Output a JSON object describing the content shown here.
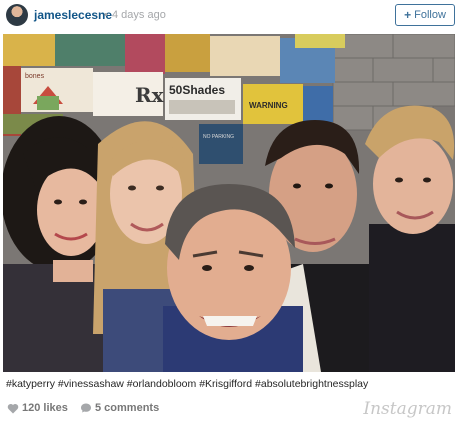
{
  "post": {
    "username": "jameslecesne",
    "separator": "•",
    "time_ago": "4 days ago",
    "follow_label": "Follow",
    "caption": "#katyperry #vinessashaw #orlandobloom #Krisgifford #absolutebrightnessplay",
    "likes": "120 likes",
    "comments": "5 comments",
    "brand": "Instagram"
  },
  "photo_signs": {
    "sign_1": "50Shades",
    "sign_2": "WARNING",
    "sign_3": "Rx",
    "sign_4": "bones",
    "sign_5": "NO PARKING"
  },
  "colors": {
    "username": "#125688",
    "follow_border": "#3f729b",
    "meta_text": "#a5a7aa",
    "footer_text": "#777777"
  },
  "icons": {
    "follow": "plus-icon",
    "likes": "heart-icon",
    "comments": "comment-bubble-icon"
  }
}
